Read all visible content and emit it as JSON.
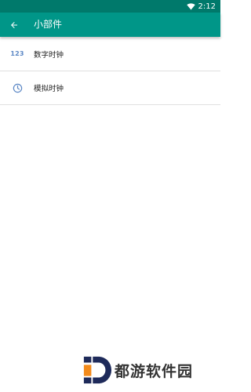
{
  "status_bar": {
    "time": "2:12",
    "bg_color": "#00796b",
    "icons": [
      "wifi-icon"
    ]
  },
  "toolbar": {
    "title": "小部件",
    "bg_color": "#009688",
    "back_icon": "arrow-back-icon"
  },
  "items": [
    {
      "icon": "123",
      "icon_name": "digits-icon",
      "label": "数字时钟"
    },
    {
      "icon_name": "clock-icon",
      "label": "模拟时钟"
    }
  ],
  "watermark": {
    "text": "都游软件园",
    "accent_colors": [
      "#1e2a5a",
      "#f28a1b"
    ]
  }
}
